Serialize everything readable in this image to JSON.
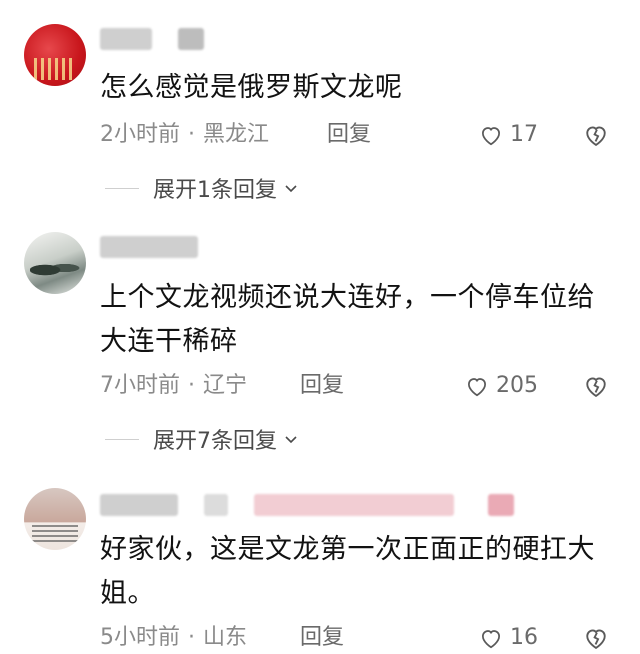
{
  "comments": [
    {
      "text": "怎么感觉是俄罗斯文龙呢",
      "time": "2小时前",
      "location": "黑龙江",
      "reply_label": "回复",
      "likes": "17",
      "expand_label": "展开1条回复"
    },
    {
      "text": "上个文龙视频还说大连好，一个停车位给大连干稀碎",
      "time": "7小时前",
      "location": "辽宁",
      "reply_label": "回复",
      "likes": "205",
      "expand_label": "展开7条回复"
    },
    {
      "text": "好家伙，这是文龙第一次正面正的硬扛大姐。",
      "time": "5小时前",
      "location": "山东",
      "reply_label": "回复",
      "likes": "16"
    }
  ],
  "separator": "·"
}
